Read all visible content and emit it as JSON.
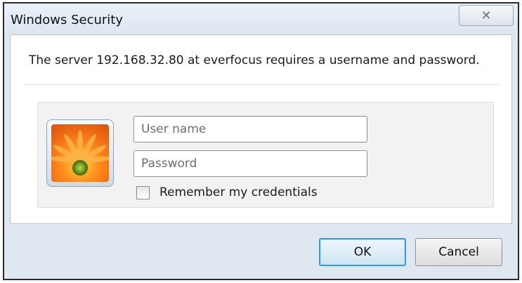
{
  "window": {
    "title": "Windows Security",
    "close_glyph": "✕"
  },
  "message": "The server 192.168.32.80 at everfocus requires a username and password.",
  "credentials": {
    "user_icon": "flower-user-icon",
    "username": {
      "value": "",
      "placeholder": "User name"
    },
    "password": {
      "value": "",
      "placeholder": "Password"
    },
    "remember": {
      "label": "Remember my credentials",
      "checked": false
    }
  },
  "buttons": {
    "ok_label": "OK",
    "cancel_label": "Cancel"
  },
  "colors": {
    "default_button_border": "#3c9bd6",
    "frame_background": "#dfe8f1"
  }
}
